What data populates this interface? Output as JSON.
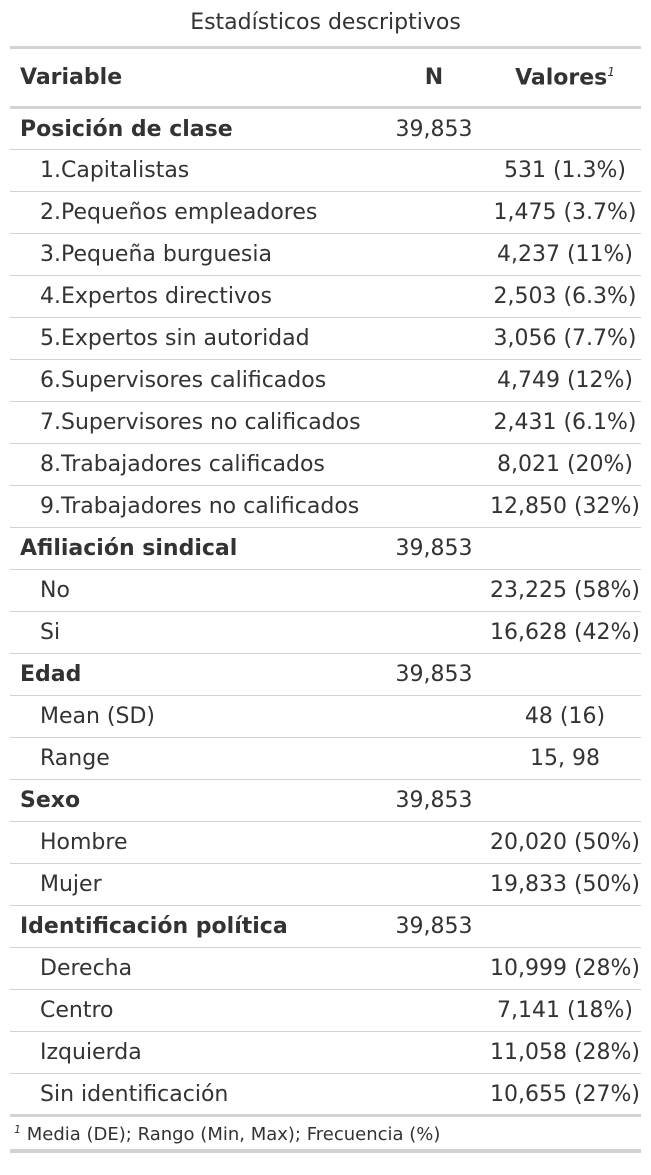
{
  "title": "Estadísticos descriptivos",
  "header": {
    "variable": "Variable",
    "n": "N",
    "values": "Valores",
    "values_footnote_mark": "1"
  },
  "rows": [
    {
      "type": "group",
      "label": "Posición de clase",
      "n": "39,853",
      "value": ""
    },
    {
      "type": "sub",
      "label": "1.Capitalistas",
      "n": "",
      "value": "531 (1.3%)"
    },
    {
      "type": "sub",
      "label": "2.Pequeños empleadores",
      "n": "",
      "value": "1,475 (3.7%)"
    },
    {
      "type": "sub",
      "label": "3.Pequeña burguesia",
      "n": "",
      "value": "4,237 (11%)"
    },
    {
      "type": "sub",
      "label": "4.Expertos directivos",
      "n": "",
      "value": "2,503 (6.3%)"
    },
    {
      "type": "sub",
      "label": "5.Expertos sin autoridad",
      "n": "",
      "value": "3,056 (7.7%)"
    },
    {
      "type": "sub",
      "label": "6.Supervisores calificados",
      "n": "",
      "value": "4,749 (12%)"
    },
    {
      "type": "sub",
      "label": "7.Supervisores no calificados",
      "n": "",
      "value": "2,431 (6.1%)"
    },
    {
      "type": "sub",
      "label": "8.Trabajadores calificados",
      "n": "",
      "value": "8,021 (20%)"
    },
    {
      "type": "sub",
      "label": "9.Trabajadores no calificados",
      "n": "",
      "value": "12,850 (32%)"
    },
    {
      "type": "group",
      "label": "Afiliación sindical",
      "n": "39,853",
      "value": ""
    },
    {
      "type": "sub",
      "label": "No",
      "n": "",
      "value": "23,225 (58%)"
    },
    {
      "type": "sub",
      "label": "Si",
      "n": "",
      "value": "16,628 (42%)"
    },
    {
      "type": "group",
      "label": "Edad",
      "n": "39,853",
      "value": ""
    },
    {
      "type": "sub",
      "label": "Mean (SD)",
      "n": "",
      "value": "48 (16)"
    },
    {
      "type": "sub",
      "label": "Range",
      "n": "",
      "value": "15, 98"
    },
    {
      "type": "group",
      "label": "Sexo",
      "n": "39,853",
      "value": ""
    },
    {
      "type": "sub",
      "label": "Hombre",
      "n": "",
      "value": "20,020 (50%)"
    },
    {
      "type": "sub",
      "label": "Mujer",
      "n": "",
      "value": "19,833 (50%)"
    },
    {
      "type": "group",
      "label": "Identificación política",
      "n": "39,853",
      "value": ""
    },
    {
      "type": "sub",
      "label": "Derecha",
      "n": "",
      "value": "10,999 (28%)"
    },
    {
      "type": "sub",
      "label": "Centro",
      "n": "",
      "value": "7,141 (18%)"
    },
    {
      "type": "sub",
      "label": "Izquierda",
      "n": "",
      "value": "11,058 (28%)"
    },
    {
      "type": "sub",
      "label": "Sin identificación",
      "n": "",
      "value": "10,655 (27%)"
    }
  ],
  "footnote": {
    "mark": "1",
    "text": "Media (DE); Rango (Min, Max); Frecuencia (%)"
  }
}
